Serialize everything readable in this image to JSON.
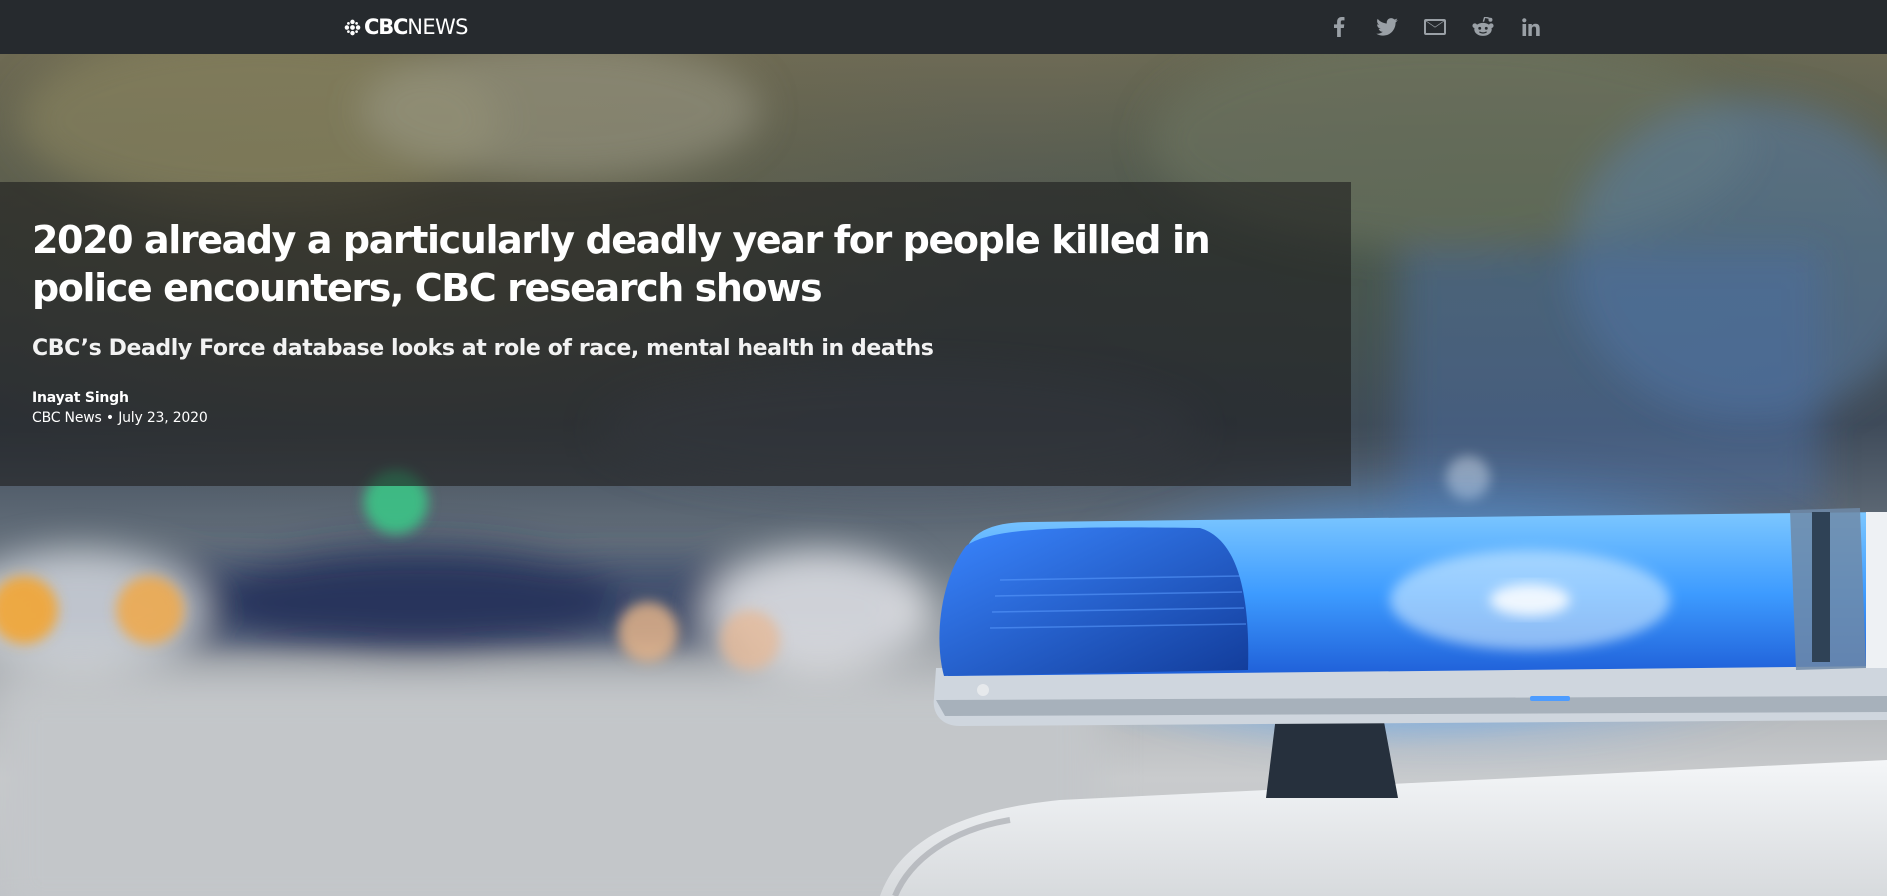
{
  "header": {
    "logo": {
      "brand": "CBC",
      "section": "NEWS"
    },
    "share_buttons": [
      {
        "name": "facebook",
        "icon": "facebook-icon"
      },
      {
        "name": "twitter",
        "icon": "twitter-icon"
      },
      {
        "name": "email",
        "icon": "email-icon"
      },
      {
        "name": "reddit",
        "icon": "reddit-icon"
      },
      {
        "name": "linkedin",
        "icon": "linkedin-icon"
      }
    ]
  },
  "article": {
    "headline": "2020 already a particularly deadly year for people killed in police encounters, CBC research shows",
    "deck": "CBC’s Deadly Force database looks at role of race, mental health in deaths",
    "author": "Inayat Singh",
    "source": "CBC News",
    "separator": "•",
    "date": "July 23, 2020"
  },
  "hero_image": {
    "subject": "blurred street with police car light bar",
    "accent": "#2b7fff"
  },
  "colors": {
    "topbar": "#262a2e",
    "icon": "#9aa0a6",
    "text": "#ffffff"
  }
}
